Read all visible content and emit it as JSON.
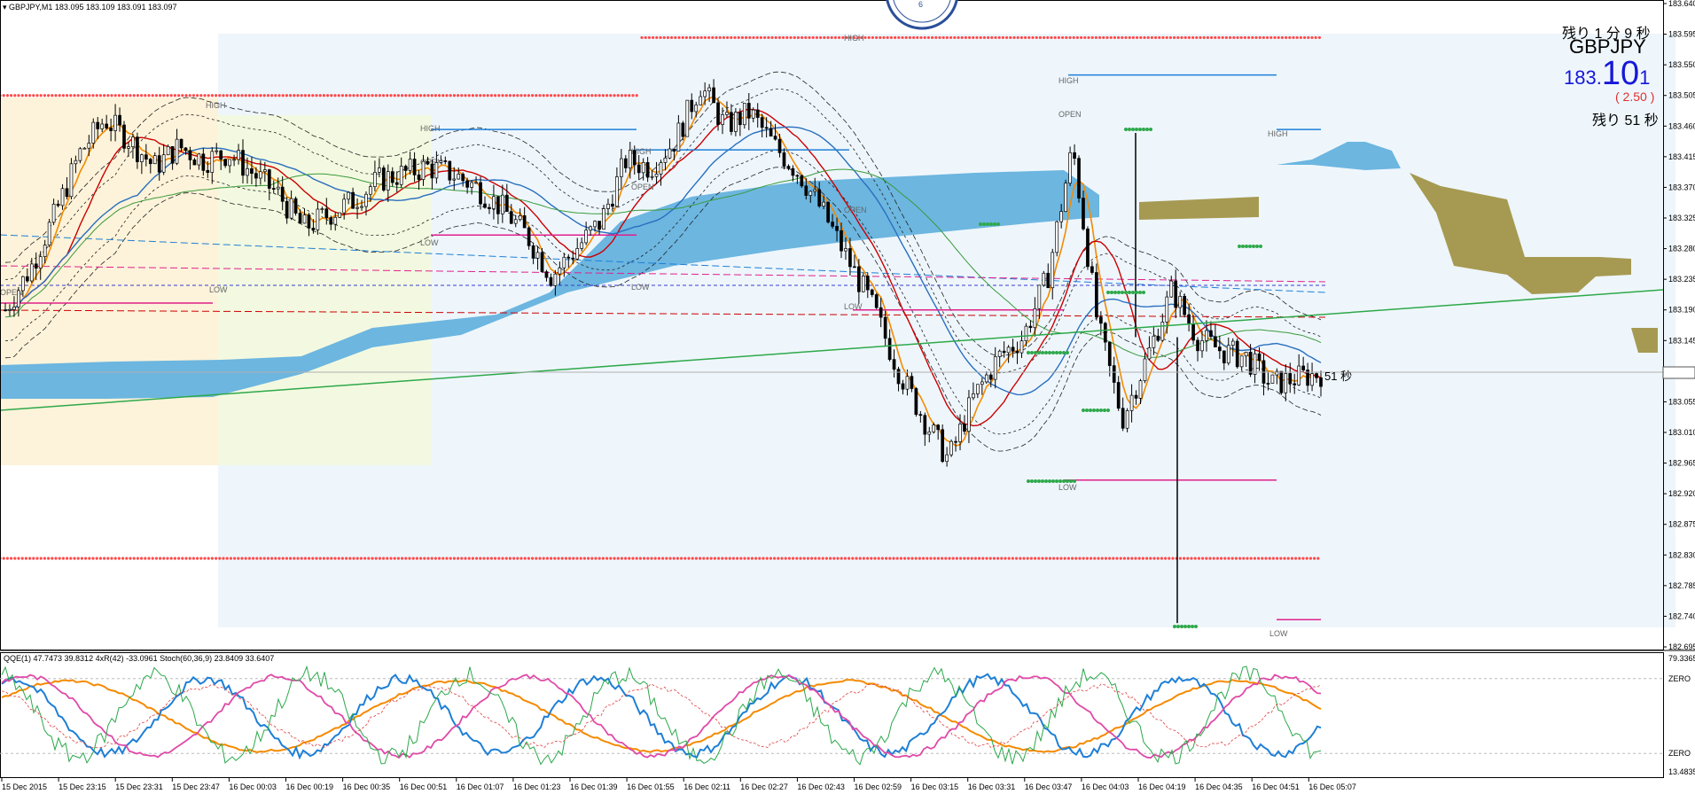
{
  "header": {
    "symbol_tf": "GBPJPY,M1",
    "ohlc": "183.095 183.109 183.091 183.097"
  },
  "overlay": {
    "timer_top": "残り 1 分 9 秒",
    "pair": "GBPJPY",
    "price_small": "183.",
    "price_big": "10",
    "price_last": "1",
    "change": "( 2.50 )",
    "timer_bottom": "残り 51 秒",
    "candle_timer": "51 秒"
  },
  "colors": {
    "bg": "#ffffff",
    "zone_light_blue": "#eef6fc",
    "zone_yellow": "#fdf3da",
    "zone_green": "#f3f9e0",
    "cloud_blue": "#6cb6e0",
    "cloud_olive": "#a69a52",
    "candle": "#000000",
    "ma_red": "#cc0000",
    "ma_orange": "#f58a00",
    "ma_blue": "#2a6fbf",
    "ma_green": "#3a9a3a",
    "dots_red": "#ff4a4a",
    "dots_green": "#2ea84a",
    "pivot_blue": "#1e7fd6",
    "pivot_pink": "#e0208a",
    "trend_green": "#2ea84a",
    "qqe_blue": "#1e7fd6",
    "qqe_orange": "#f58a00",
    "stoch_pink": "#e04aa8",
    "stoch_green": "#2aa84a"
  },
  "chart_data": {
    "type": "candlestick",
    "symbol": "GBPJPY",
    "timeframe": "M1",
    "ylim": [
      182.695,
      183.64
    ],
    "y_ticks": [
      "183.640",
      "183.595",
      "183.550",
      "183.505",
      "183.460",
      "183.415",
      "183.370",
      "183.325",
      "183.280",
      "183.235",
      "183.190",
      "183.145",
      "183.097",
      "183.055",
      "183.010",
      "182.965",
      "182.920",
      "182.875",
      "182.830",
      "182.785",
      "182.740",
      "182.695"
    ],
    "current_price": 183.097,
    "x_ticks": [
      "15 Dec 2015",
      "15 Dec 23:15",
      "15 Dec 23:31",
      "15 Dec 23:47",
      "16 Dec 00:03",
      "16 Dec 00:19",
      "16 Dec 00:35",
      "16 Dec 00:51",
      "16 Dec 01:07",
      "16 Dec 01:23",
      "16 Dec 01:39",
      "16 Dec 01:55",
      "16 Dec 02:11",
      "16 Dec 02:27",
      "16 Dec 02:43",
      "16 Dec 02:59",
      "16 Dec 03:15",
      "16 Dec 03:31",
      "16 Dec 03:47",
      "16 Dec 04:03",
      "16 Dec 04:19",
      "16 Dec 04:35",
      "16 Dec 04:51",
      "16 Dec 05:07"
    ],
    "price_path": [
      183.19,
      183.25,
      183.33,
      183.42,
      183.47,
      183.44,
      183.4,
      183.43,
      183.41,
      183.42,
      183.39,
      183.36,
      183.31,
      183.33,
      183.35,
      183.38,
      183.39,
      183.4,
      183.39,
      183.37,
      183.34,
      183.3,
      183.24,
      183.28,
      183.32,
      183.41,
      183.4,
      183.44,
      183.52,
      183.46,
      183.48,
      183.43,
      183.39,
      183.33,
      183.26,
      183.19,
      183.1,
      183.03,
      182.97,
      183.06,
      183.12,
      183.15,
      183.24,
      183.43,
      183.17,
      183.03,
      183.12,
      183.22,
      183.15,
      183.13,
      183.12,
      183.08,
      183.09,
      183.097
    ],
    "candle_spikes": [
      {
        "t": "16 Dec 04:14",
        "low": 182.73
      },
      {
        "t": "16 Dec 03:59",
        "high": 183.45
      }
    ],
    "levels": {
      "resistance_dots": [
        183.59,
        183.505
      ],
      "support_dots": [
        182.825
      ],
      "pivot_lines_blue": [
        183.455,
        183.425,
        183.535,
        183.455
      ],
      "pivot_lines_pink": [
        183.3,
        183.19,
        183.2,
        182.94,
        182.735
      ]
    },
    "level_labels": [
      "HIGH",
      "HIGH",
      "HIGH",
      "HIGH",
      "HIGH",
      "HIGH",
      "OPEN",
      "OPEN",
      "OPEN",
      "OPEN",
      "OPEN",
      "LOW",
      "LOW",
      "LOW",
      "LOW",
      "LOW",
      "LOW"
    ],
    "subwindow": {
      "title": "QQE(1) 47.7473 39.8312  4xR(42) -33.0961  Stoch(60,36,9) 23.8409 33.6407",
      "y_ticks": [
        "79.3365",
        "ZERO",
        "ZERO",
        "13.4835"
      ],
      "ylim": [
        13.4835,
        79.3365
      ]
    }
  }
}
